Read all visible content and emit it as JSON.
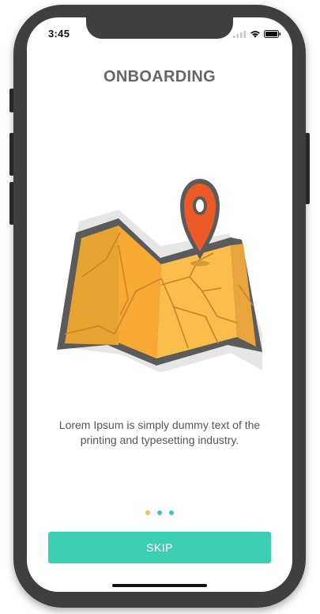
{
  "status_bar": {
    "time": "3:45",
    "icons": [
      "signal-icon",
      "wifi-icon",
      "battery-icon"
    ]
  },
  "screen": {
    "title": "ONBOARDING",
    "illustration": "map-with-location-pin",
    "description": "Lorem Ipsum is simply dummy text of the printing and typesetting industry."
  },
  "pager": {
    "page_count": 3,
    "active_index": 0,
    "active_color": "#f0c24a",
    "inactive_color": "#3cc9b2"
  },
  "skip_button": {
    "label": "SKIP",
    "color": "#3ccfb3"
  }
}
